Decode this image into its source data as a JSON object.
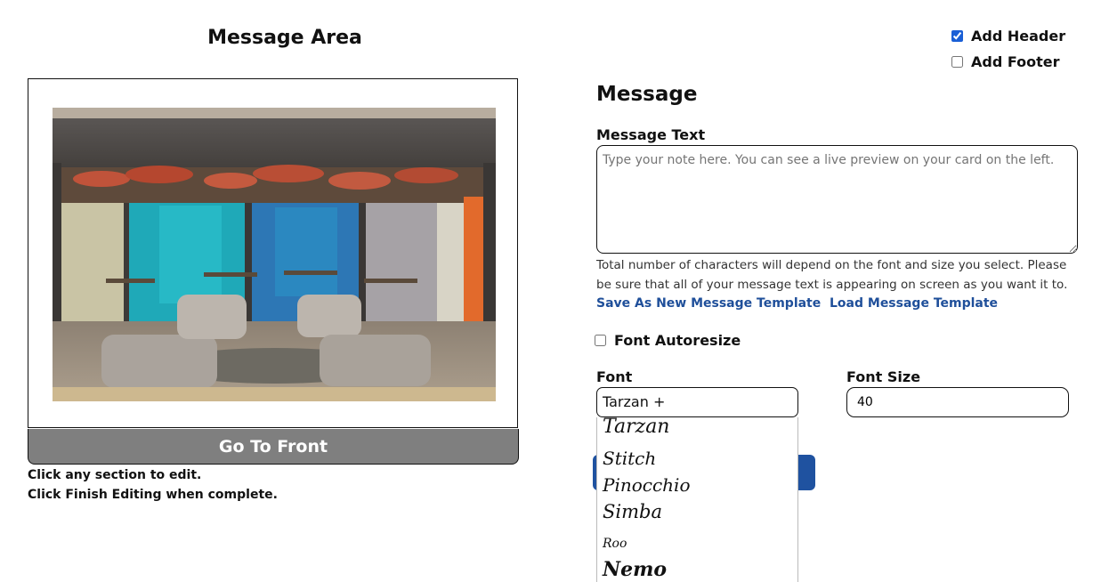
{
  "left": {
    "title": "Message Area",
    "go_front_label": "Go To Front",
    "hint_line1": "Click any section to edit.",
    "hint_line2": "Click Finish Editing when complete."
  },
  "options": {
    "add_header": {
      "label": "Add Header",
      "checked": true
    },
    "add_footer": {
      "label": "Add Footer",
      "checked": false
    }
  },
  "message": {
    "heading": "Message",
    "text_label": "Message Text",
    "text_placeholder": "Type your note here. You can see a live preview on your card on the left.",
    "note": "Total number of characters will depend on the font and size you select. Please be sure that all of your message text is appearing on screen as you want it to.",
    "save_template": "Save As New Message Template",
    "load_template": "Load Message Template",
    "autoresize_label": "Font Autoresize",
    "font_label": "Font",
    "font_value": "Tarzan +",
    "size_label": "Font Size",
    "size_value": "40",
    "font_options": [
      "Tarzan",
      "Stitch",
      "Pinocchio",
      "Simba",
      "Roo",
      "Nemo"
    ]
  },
  "colors": {
    "accent": "#1f52a0",
    "link": "#1f4f9a",
    "go_front_bg": "#7f7f7f"
  }
}
